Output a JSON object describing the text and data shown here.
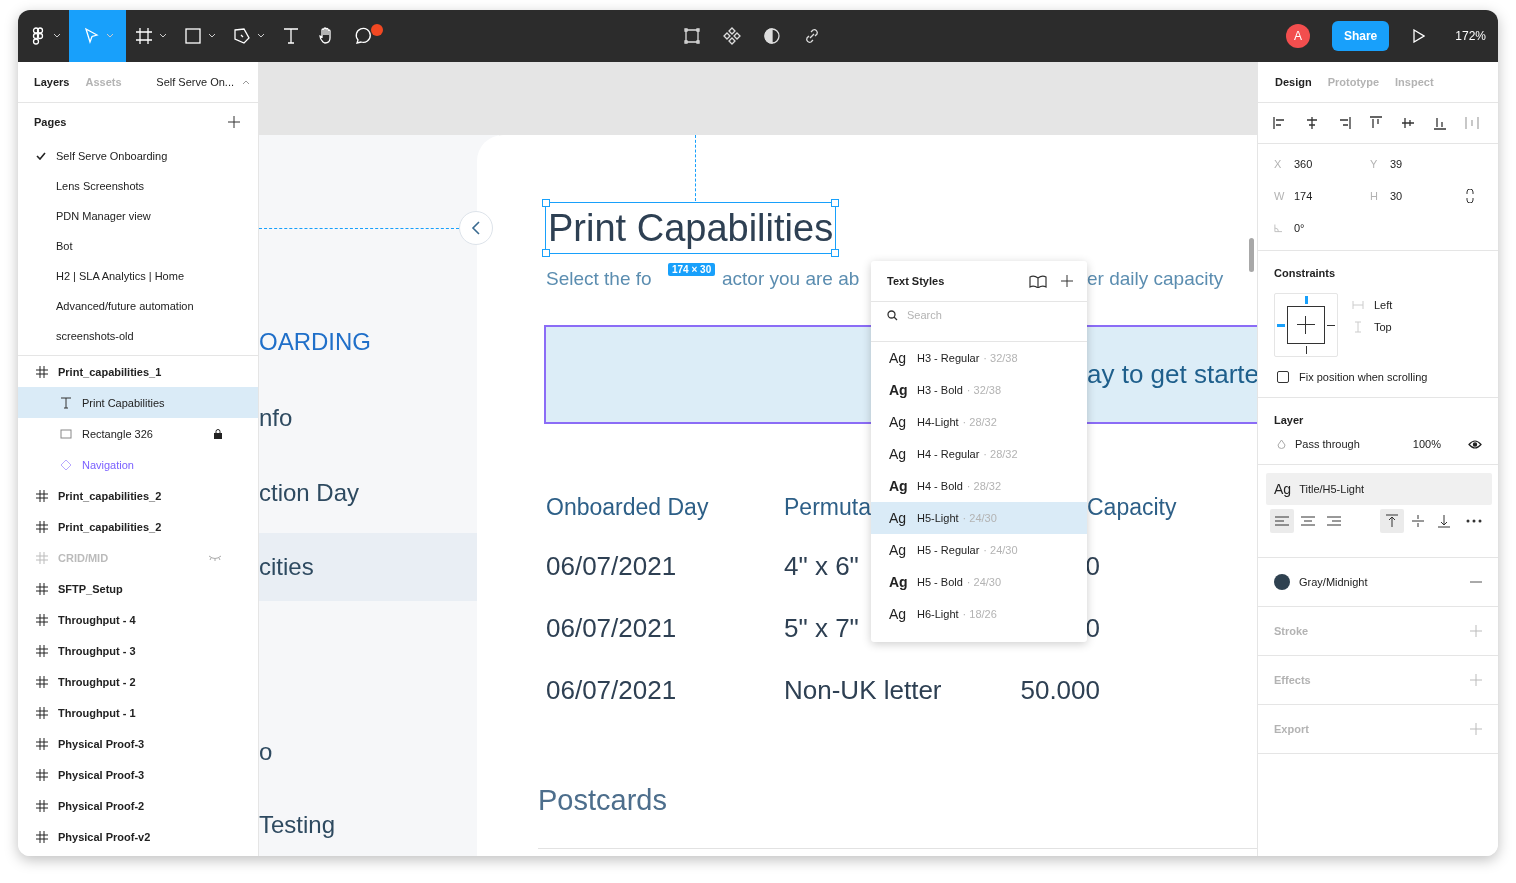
{
  "toolbar": {
    "tools": [
      {
        "kind": "logo",
        "selected": false,
        "caret": true
      },
      {
        "kind": "move",
        "selected": true,
        "caret": true
      },
      {
        "kind": "frame",
        "selected": false,
        "caret": true
      },
      {
        "kind": "shape",
        "selected": false,
        "caret": true
      },
      {
        "kind": "pen",
        "selected": false,
        "caret": true
      },
      {
        "kind": "text",
        "selected": false,
        "caret": false
      },
      {
        "kind": "hand",
        "selected": false,
        "caret": false
      },
      {
        "kind": "comment",
        "selected": false,
        "caret": false,
        "badge": true
      }
    ],
    "center_tools": [
      {
        "kind": "crop"
      },
      {
        "kind": "component"
      },
      {
        "kind": "contrast"
      },
      {
        "kind": "link"
      }
    ],
    "avatar": "A",
    "share": "Share",
    "zoom": "172%"
  },
  "left_panel": {
    "tabs": [
      {
        "label": "Layers",
        "selected": true
      },
      {
        "label": "Assets",
        "selected": false
      }
    ],
    "page_picker": "Self Serve On...",
    "pages_title": "Pages",
    "pages": [
      {
        "label": "Self Serve Onboarding",
        "selected": true
      },
      {
        "label": "Lens Screenshots",
        "selected": false
      },
      {
        "label": "PDN Manager view",
        "selected": false
      },
      {
        "label": "Bot",
        "selected": false
      },
      {
        "label": "H2 | SLA Analytics | Home",
        "selected": false
      },
      {
        "label": "Advanced/future automation",
        "selected": false
      },
      {
        "label": "screenshots-old",
        "selected": false
      }
    ],
    "layers": [
      {
        "label": "Print_capabilities_1",
        "kind": "frame",
        "selected": false,
        "locked": false,
        "hidden": false,
        "children": [
          {
            "label": "Print Capabilities",
            "kind": "text",
            "selected": true,
            "locked": false,
            "hidden": false
          },
          {
            "label": "Rectangle 326",
            "kind": "rect",
            "selected": false,
            "locked": true,
            "hidden": false
          },
          {
            "label": "Navigation",
            "kind": "component",
            "selected": false,
            "locked": false,
            "hidden": false
          }
        ]
      },
      {
        "label": "Print_capabilities_2",
        "kind": "frame",
        "selected": false,
        "locked": false,
        "hidden": false
      },
      {
        "label": "Print_capabilities_2",
        "kind": "frame",
        "selected": false,
        "locked": false,
        "hidden": false
      },
      {
        "label": "CRID/MID",
        "kind": "frame",
        "selected": false,
        "locked": false,
        "hidden": true
      },
      {
        "label": "SFTP_Setup",
        "kind": "frame",
        "selected": false,
        "locked": false,
        "hidden": false
      },
      {
        "label": "Throughput - 4",
        "kind": "frame",
        "selected": false,
        "locked": false,
        "hidden": false
      },
      {
        "label": "Throughput - 3",
        "kind": "frame",
        "selected": false,
        "locked": false,
        "hidden": false
      },
      {
        "label": "Throughput - 2",
        "kind": "frame",
        "selected": false,
        "locked": false,
        "hidden": false
      },
      {
        "label": "Throughput - 1",
        "kind": "frame",
        "selected": false,
        "locked": false,
        "hidden": false
      },
      {
        "label": "Physical Proof-3",
        "kind": "frame",
        "selected": false,
        "locked": false,
        "hidden": false
      },
      {
        "label": "Physical Proof-3",
        "kind": "frame",
        "selected": false,
        "locked": false,
        "hidden": false
      },
      {
        "label": "Physical Proof-2",
        "kind": "frame",
        "selected": false,
        "locked": false,
        "hidden": false
      },
      {
        "label": "Physical Proof-v2",
        "kind": "frame",
        "selected": false,
        "locked": false,
        "hidden": false
      }
    ]
  },
  "canvas": {
    "nav_items": [
      {
        "label": "OARDING",
        "kind": "brand",
        "selected": false
      },
      {
        "label": "nfo",
        "kind": "item",
        "selected": false
      },
      {
        "label": "ction Day",
        "kind": "item",
        "selected": false
      },
      {
        "label": "cities",
        "kind": "item",
        "selected": true
      },
      {
        "label": "o",
        "kind": "item",
        "selected": false
      },
      {
        "label": "Testing",
        "kind": "item",
        "selected": false
      }
    ],
    "title": "Print Capabilities",
    "dimensions": "174 × 30",
    "subtitle_parts": [
      "Select the fo",
      "actor you are ab",
      "er daily capacity"
    ],
    "banner": "ay to get starte",
    "table": {
      "columns": [
        "Onboarded Day",
        "Permuta",
        "Capacity"
      ],
      "rows": [
        [
          "06/07/2021",
          "4\" x 6\"",
          "0"
        ],
        [
          "06/07/2021",
          "5\" x 7\"",
          "0"
        ],
        [
          "06/07/2021",
          "Non-UK letter",
          "50.000"
        ]
      ]
    },
    "section": "Postcards",
    "text_styles": {
      "title": "Text Styles",
      "search_placeholder": "Search",
      "items": [
        {
          "sample": "Ag",
          "name": "H3 - Regular",
          "meta": "· 32/38",
          "bold": false,
          "selected": false
        },
        {
          "sample": "Ag",
          "name": "H3 - Bold",
          "meta": "· 32/38",
          "bold": true,
          "selected": false
        },
        {
          "sample": "Ag",
          "name": "H4-Light",
          "meta": "· 28/32",
          "bold": false,
          "selected": false
        },
        {
          "sample": "Ag",
          "name": "H4 - Regular",
          "meta": "· 28/32",
          "bold": false,
          "selected": false
        },
        {
          "sample": "Ag",
          "name": "H4 - Bold",
          "meta": "· 28/32",
          "bold": true,
          "selected": false
        },
        {
          "sample": "Ag",
          "name": "H5-Light",
          "meta": "· 24/30",
          "bold": false,
          "selected": true
        },
        {
          "sample": "Ag",
          "name": "H5 - Regular",
          "meta": "· 24/30",
          "bold": false,
          "selected": false
        },
        {
          "sample": "Ag",
          "name": "H5 - Bold",
          "meta": "· 24/30",
          "bold": true,
          "selected": false
        },
        {
          "sample": "Ag",
          "name": "H6-Light",
          "meta": "· 18/26",
          "bold": false,
          "selected": false
        }
      ]
    }
  },
  "right_panel": {
    "tabs": [
      {
        "label": "Design",
        "selected": true
      },
      {
        "label": "Prototype",
        "selected": false
      },
      {
        "label": "Inspect",
        "selected": false
      }
    ],
    "align": [
      {
        "kind": "left"
      },
      {
        "kind": "hcenter"
      },
      {
        "kind": "right"
      },
      {
        "kind": "top"
      },
      {
        "kind": "vcenter"
      },
      {
        "kind": "bottom"
      },
      {
        "kind": "distribute"
      }
    ],
    "fields": [
      {
        "label": "X",
        "value": "360"
      },
      {
        "label": "Y",
        "value": "39"
      },
      {
        "label": "W",
        "value": "174"
      },
      {
        "label": "H",
        "value": "30"
      }
    ],
    "rotation": "0°",
    "constraints": {
      "title": "Constraints",
      "horizontal": "Left",
      "vertical": "Top"
    },
    "fix_position": {
      "label": "Fix position when scrolling",
      "checked": false
    },
    "layer": {
      "title": "Layer",
      "blend": "Pass through",
      "opacity": "100%"
    },
    "text_style": {
      "sample": "Ag",
      "name": "Title/H5-Light"
    },
    "text_align": [
      {
        "kind": "left",
        "selected": true
      },
      {
        "kind": "center",
        "selected": false
      },
      {
        "kind": "right",
        "selected": false
      }
    ],
    "vertical_align": [
      {
        "kind": "top",
        "selected": true
      },
      {
        "kind": "middle",
        "selected": false
      },
      {
        "kind": "bottom",
        "selected": false
      }
    ],
    "fill": {
      "name": "Gray/Midnight",
      "color": "#2f4150"
    },
    "sections": [
      "Stroke",
      "Effects",
      "Export"
    ]
  }
}
